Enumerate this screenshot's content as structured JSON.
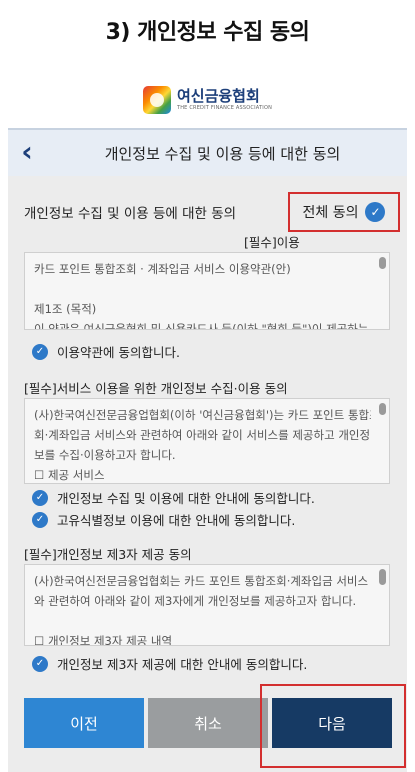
{
  "step_title": "3) 개인정보 수집 동의",
  "logo": {
    "name": "여신금융협회",
    "sub": "THE CREDIT FINANCE ASSOCIATION"
  },
  "header": {
    "title": "개인정보 수집 및 이용 등에 대한 동의"
  },
  "main_section": {
    "title": "개인정보 수집 및 이용 등에 대한 동의",
    "all_agree_label": "전체 동의"
  },
  "section1": {
    "label": "[필수]이용",
    "lines": [
      "카드 포인트 통합조회 · 계좌입금 서비스 이용약관(안)",
      "",
      "제1조 (목적)",
      "이 약관은 여신금융협회 및 신용카드사 등(이하 \"협회 등\")이 제공하는 \"카"
    ],
    "agree": "이용약관에 동의합니다."
  },
  "section2": {
    "title": "[필수]서비스 이용을 위한 개인정보 수집·이용 동의",
    "lines": [
      "(사)한국여신전문금융업협회(이하 '여신금융협회')는 카드 포인트 통합조",
      "회·계좌입금 서비스와 관련하여 아래와 같이 서비스를 제공하고 개인정",
      "보를 수집·이용하고자 합니다.",
      "☐ 제공 서비스"
    ],
    "agree1": "개인정보 수집 및 이용에 대한 안내에 동의합니다.",
    "agree2": "고유식별정보 이용에 대한 안내에 동의합니다."
  },
  "section3": {
    "title": "[필수]개인정보 제3자 제공 동의",
    "lines": [
      "(사)한국여신전문금융업협회는 카드 포인트 통합조회·계좌입금 서비스",
      "와 관련하여 아래와 같이 제3자에게 개인정보를 제공하고자 합니다.",
      "",
      "☐ 개인정보 제3자 제공 내역"
    ],
    "agree": "개인정보 제3자 제공에 대한 안내에 동의합니다."
  },
  "buttons": {
    "prev": "이전",
    "cancel": "취소",
    "next": "다음"
  },
  "icons": {
    "back": "chevron-left-icon",
    "check": "check-circle-icon"
  },
  "colors": {
    "accent": "#2e79c8",
    "next_button": "#163a64",
    "prev_button": "#2e86d3",
    "cancel_button": "#9a9d9f",
    "highlight": "#d32f2f"
  }
}
